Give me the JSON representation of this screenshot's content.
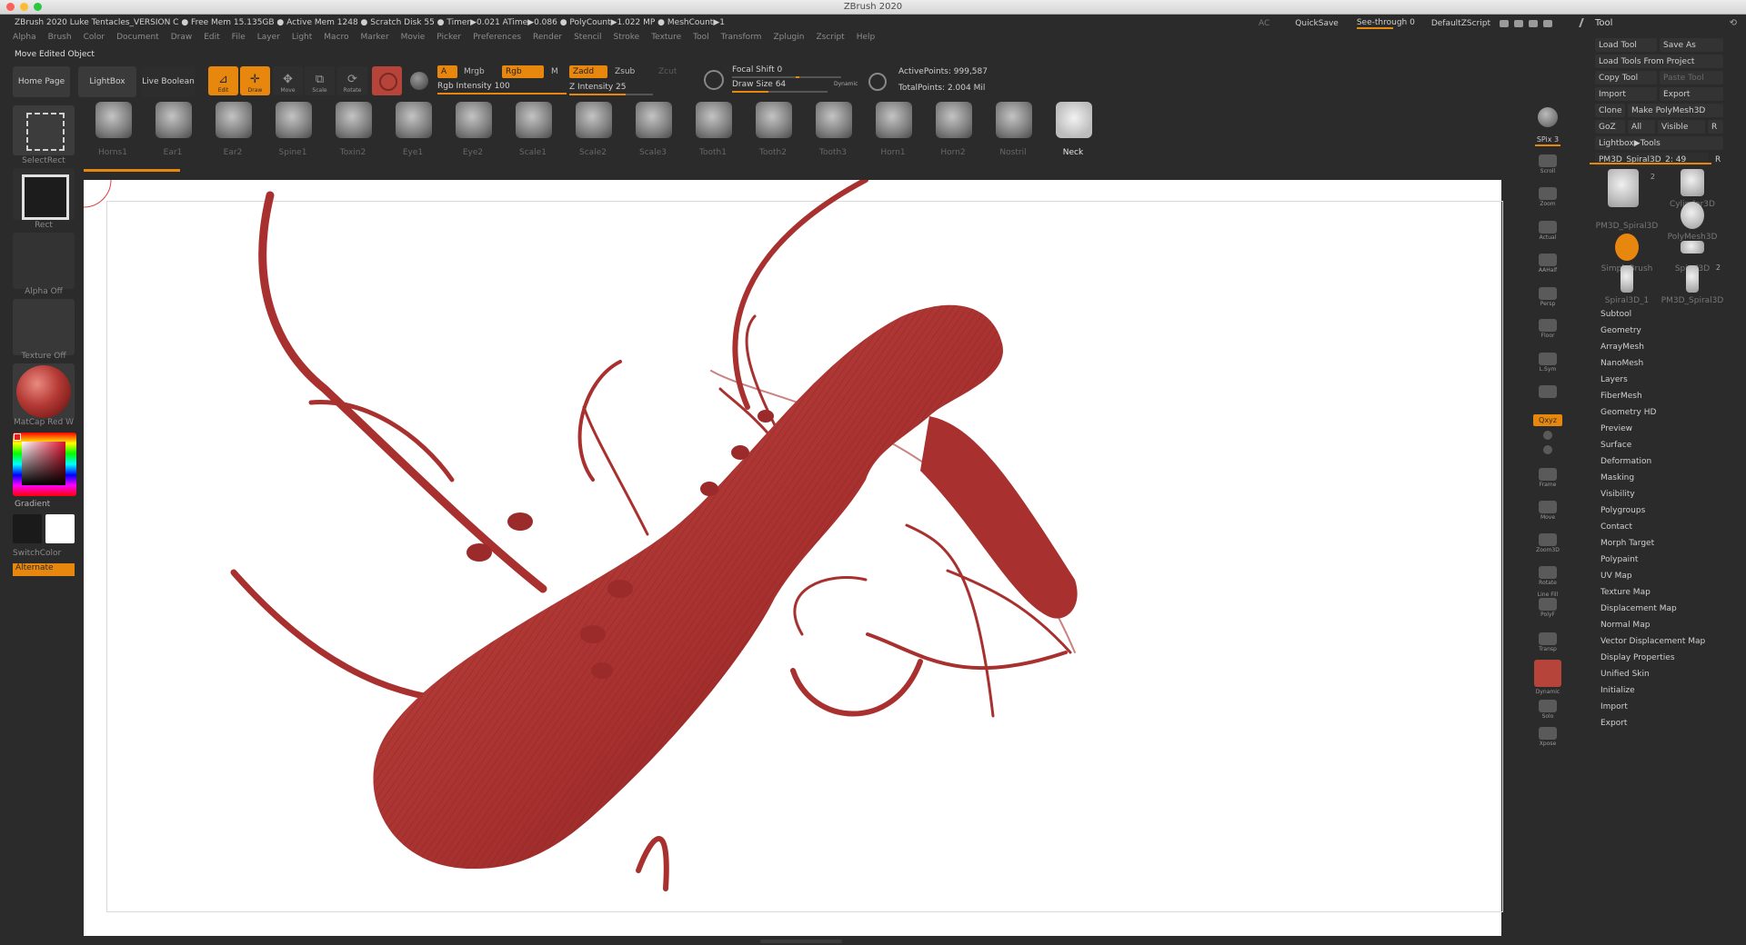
{
  "window": {
    "title": "ZBrush 2020"
  },
  "infobar": {
    "text": "ZBrush 2020 Luke Tentacles_VERSION C   ● Free Mem 15.135GB ● Active Mem 1248 ● Scratch Disk 55 ●  Timer▶0.021 ATime▶0.086 ● PolyCount▶1.022 MP  ● MeshCount▶1",
    "ac": "AC",
    "quicksave": "QuickSave",
    "see_through": "See-through  0",
    "default_zscript": "DefaultZScript"
  },
  "tool_header": {
    "title": "Tool"
  },
  "menu": [
    "Alpha",
    "Brush",
    "Color",
    "Document",
    "Draw",
    "Edit",
    "File",
    "Layer",
    "Light",
    "Macro",
    "Marker",
    "Movie",
    "Picker",
    "Preferences",
    "Render",
    "Stencil",
    "Stroke",
    "Texture",
    "Tool",
    "Transform",
    "Zplugin",
    "Zscript",
    "Help"
  ],
  "status": "Move Edited Object",
  "shelf": {
    "home_page": "Home Page",
    "lightbox": "LightBox",
    "live_boolean": "Live Boolean",
    "edit": "Edit",
    "draw": "Draw",
    "move": "Move",
    "scale": "Scale",
    "rotate": "Rotate",
    "a": "A",
    "mrgb": "Mrgb",
    "rgb": "Rgb",
    "m": "M",
    "zadd": "Zadd",
    "zsub": "Zsub",
    "zcut": "Zcut",
    "rgb_intensity": "Rgb Intensity 100",
    "rgb_intensity_value": 100,
    "z_intensity": "Z Intensity 25",
    "z_intensity_value": 25,
    "focal_shift": "Focal Shift 0",
    "focal_shift_value": 0,
    "draw_size": "Draw Size 64",
    "draw_size_value": 64,
    "dynamic": "Dynamic",
    "active_points": "ActivePoints: 999,587",
    "total_points": "TotalPoints: 2.004 Mil"
  },
  "left": {
    "select_rect": "SelectRect",
    "rect": "Rect",
    "alpha_off": "Alpha Off",
    "texture_off": "Texture Off",
    "matcap": "MatCap Red W",
    "gradient": "Gradient",
    "switch_color": "SwitchColor",
    "alternate": "Alternate"
  },
  "thumbnails": [
    "Horns1",
    "Ear1",
    "Ear2",
    "Spine1",
    "Toxin2",
    "Eye1",
    "Eye2",
    "Scale1",
    "Scale2",
    "Scale3",
    "Tooth1",
    "Tooth2",
    "Tooth3",
    "Horn1",
    "Horn2",
    "Nostril",
    "Neck"
  ],
  "active_thumbnail": "Neck",
  "right_shelf": {
    "spix": "SPix 3",
    "scroll": "Scroll",
    "zoom": "Zoom",
    "actual": "Actual",
    "aahalf": "AAHalf",
    "persp": "Persp",
    "floor": "Floor",
    "lsym": "L.Sym",
    "xyz": "Qxyz",
    "frame": "Frame",
    "move": "Move",
    "zoom3d": "Zoom3D",
    "rotate": "Rotate",
    "linefill": "Line Fill",
    "polyf": "PolyF",
    "transp": "Transp",
    "dynamic": "Dynamic",
    "solo": "Solo",
    "xpose": "Xpose"
  },
  "toolpanel": {
    "load_tool": "Load Tool",
    "save_as": "Save As",
    "load_from_project": "Load Tools From Project",
    "copy_tool": "Copy Tool",
    "paste_tool": "Paste Tool",
    "import": "Import",
    "export": "Export",
    "clone": "Clone",
    "make_polymesh": "Make PolyMesh3D",
    "goz": "GoZ",
    "all": "All",
    "visible": "Visible",
    "r": "R",
    "lightbox_tools": "Lightbox▶Tools",
    "fm_slider": "PM3D_Spiral3D_2: 49",
    "fm_value": 49,
    "tools": [
      {
        "name": "PM3D_Spiral3D",
        "badge": "2"
      },
      {
        "name": "Cylinder3D",
        "badge": ""
      },
      {
        "name": "SimpleBrush",
        "badge": ""
      },
      {
        "name": "PolyMesh3D",
        "badge": ""
      },
      {
        "name": "Spiral3D_1",
        "badge": ""
      },
      {
        "name": "Spiral3D",
        "badge": ""
      },
      {
        "name": "PM3D_Spiral3D",
        "badge": "2"
      }
    ],
    "menu": [
      "Subtool",
      "Geometry",
      "ArrayMesh",
      "NanoMesh",
      "Layers",
      "FiberMesh",
      "Geometry HD",
      "Preview",
      "Surface",
      "Deformation",
      "Masking",
      "Visibility",
      "Polygroups",
      "Contact",
      "Morph Target",
      "Polypaint",
      "UV Map",
      "Texture Map",
      "Displacement Map",
      "Normal Map",
      "Vector Displacement Map",
      "Display Properties",
      "Unified Skin",
      "Initialize",
      "Import",
      "Export"
    ]
  },
  "colors": {
    "accent": "#e8870e",
    "model": "#b23a38",
    "canvas": "#ffffff",
    "panel": "#2b2b2b"
  }
}
